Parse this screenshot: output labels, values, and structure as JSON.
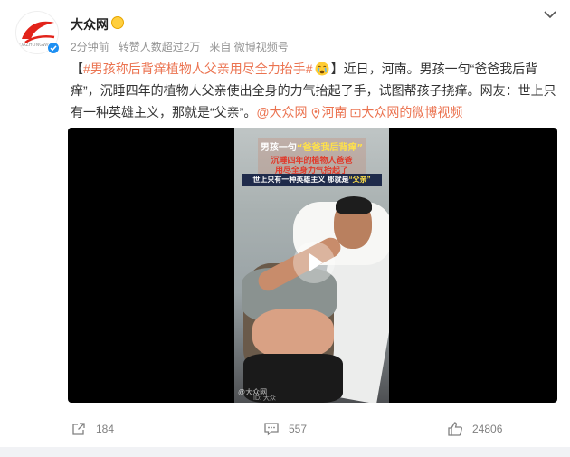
{
  "post": {
    "author": "大众网",
    "time": "2分钟前",
    "reposts_note": "转赞人数超过2万",
    "source": "来自 微博视频号",
    "bracket_open": "【",
    "topic": "#男孩称后背痒植物人父亲用尽全力抬手#",
    "bracket_close": "】",
    "body": "近日，河南。男孩一句“爸爸我后背痒”，沉睡四年的植物人父亲使出全身的力气抬起了手，试图帮孩子挠痒。网友：世上只有一种英雄主义，那就是“父亲”。",
    "mention": "@大众网",
    "location": "河南",
    "video_link": "大众网的微博视频"
  },
  "video": {
    "caption_line1_prefix": "男孩一句",
    "caption_line1_quote": "“爸爸我后背痒”",
    "caption_line2": "沉睡四年的植物人爸爸",
    "caption_line3": "用尽全身力气抬起了",
    "caption_line4": "世上只有一种英雄主义 那就是",
    "caption_line4_quote": "“父亲”",
    "watermark_name": "@大众网",
    "watermark_id": "ID: 大众"
  },
  "actions": {
    "repost_count": "184",
    "comment_count": "557",
    "like_count": "24806"
  },
  "icons": {
    "more": "chevron-down-icon",
    "repost": "share-icon",
    "comment": "comment-icon",
    "like": "thumbs-up-icon",
    "verified": "verified-badge-icon",
    "location": "location-pin-icon",
    "video": "video-icon"
  },
  "colors": {
    "topic": "#eb7350",
    "verified": "#1d8ff2",
    "meta": "#939393"
  }
}
